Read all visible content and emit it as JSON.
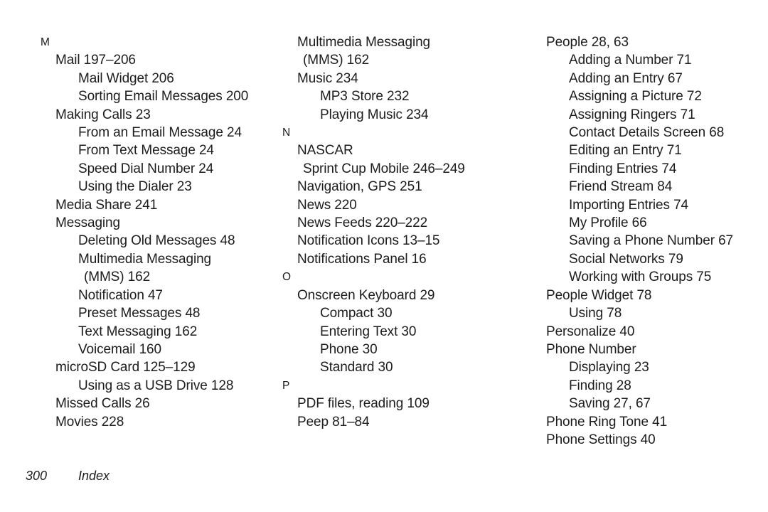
{
  "page": {
    "footer": {
      "page_number": "300",
      "label": "Index"
    }
  },
  "columns": [
    {
      "name": "column-1",
      "entries": [
        {
          "level": "letter",
          "text": "M"
        },
        {
          "level": "level1",
          "text": "Mail 197–206"
        },
        {
          "level": "level2",
          "text": "Mail Widget 206"
        },
        {
          "level": "level2",
          "text": "Sorting Email Messages 200"
        },
        {
          "level": "level1",
          "text": "Making Calls 23"
        },
        {
          "level": "level2",
          "text": "From an Email Message 24"
        },
        {
          "level": "level2",
          "text": "From Text Message 24"
        },
        {
          "level": "level2",
          "text": "Speed Dial Number 24"
        },
        {
          "level": "level2",
          "text": "Using the Dialer 23"
        },
        {
          "level": "level1",
          "text": "Media Share 241"
        },
        {
          "level": "level1",
          "text": "Messaging"
        },
        {
          "level": "level2",
          "text": "Deleting Old Messages 48"
        },
        {
          "level": "level2",
          "text": "Multimedia Messaging"
        },
        {
          "level": "cont2",
          "text": "(MMS) 162"
        },
        {
          "level": "level2",
          "text": "Notification 47"
        },
        {
          "level": "level2",
          "text": "Preset Messages 48"
        },
        {
          "level": "level2",
          "text": "Text Messaging 162"
        },
        {
          "level": "level2",
          "text": "Voicemail 160"
        },
        {
          "level": "level1",
          "text": "microSD Card 125–129"
        },
        {
          "level": "level2",
          "text": "Using as a USB Drive 128"
        },
        {
          "level": "level1",
          "text": "Missed Calls 26"
        },
        {
          "level": "level1",
          "text": "Movies 228"
        }
      ]
    },
    {
      "name": "column-2",
      "entries": [
        {
          "level": "level1",
          "text": "Multimedia Messaging"
        },
        {
          "level": "cont1",
          "text": "(MMS) 162"
        },
        {
          "level": "level1",
          "text": "Music 234"
        },
        {
          "level": "level2",
          "text": "MP3 Store 232"
        },
        {
          "level": "level2",
          "text": "Playing Music 234"
        },
        {
          "level": "letter",
          "text": "N"
        },
        {
          "level": "level1",
          "text": "NASCAR"
        },
        {
          "level": "cont1",
          "text": "Sprint Cup Mobile 246–249"
        },
        {
          "level": "level1",
          "text": "Navigation, GPS 251"
        },
        {
          "level": "level1",
          "text": "News 220"
        },
        {
          "level": "level1",
          "text": "News Feeds 220–222"
        },
        {
          "level": "level1",
          "text": "Notification Icons 13–15"
        },
        {
          "level": "level1",
          "text": "Notifications Panel 16"
        },
        {
          "level": "letter",
          "text": "O"
        },
        {
          "level": "level1",
          "text": "Onscreen Keyboard 29"
        },
        {
          "level": "level2",
          "text": "Compact 30"
        },
        {
          "level": "level2",
          "text": "Entering Text 30"
        },
        {
          "level": "level2",
          "text": "Phone 30"
        },
        {
          "level": "level2",
          "text": "Standard 30"
        },
        {
          "level": "letter",
          "text": "P"
        },
        {
          "level": "level1",
          "text": "PDF files, reading 109"
        },
        {
          "level": "level1",
          "text": "Peep 81–84"
        }
      ]
    },
    {
      "name": "column-3",
      "entries": [
        {
          "level": "level1",
          "text": "People 28, 63"
        },
        {
          "level": "level2",
          "text": "Adding a Number 71"
        },
        {
          "level": "level2",
          "text": "Adding an Entry 67"
        },
        {
          "level": "level2",
          "text": "Assigning a Picture 72"
        },
        {
          "level": "level2",
          "text": "Assigning Ringers 71"
        },
        {
          "level": "level2",
          "text": "Contact Details Screen 68"
        },
        {
          "level": "level2",
          "text": "Editing an Entry 71"
        },
        {
          "level": "level2",
          "text": "Finding Entries 74"
        },
        {
          "level": "level2",
          "text": "Friend Stream 84"
        },
        {
          "level": "level2",
          "text": "Importing Entries 74"
        },
        {
          "level": "level2",
          "text": "My Profile 66"
        },
        {
          "level": "level2",
          "text": "Saving a Phone Number 67"
        },
        {
          "level": "level2",
          "text": "Social Networks 79"
        },
        {
          "level": "level2",
          "text": "Working with Groups 75"
        },
        {
          "level": "level1",
          "text": "People Widget 78"
        },
        {
          "level": "level2",
          "text": "Using 78"
        },
        {
          "level": "level1",
          "text": "Personalize 40"
        },
        {
          "level": "level1",
          "text": "Phone Number"
        },
        {
          "level": "level2",
          "text": "Displaying 23"
        },
        {
          "level": "level2",
          "text": "Finding 28"
        },
        {
          "level": "level2",
          "text": "Saving 27, 67"
        },
        {
          "level": "level1",
          "text": "Phone Ring Tone 41"
        },
        {
          "level": "level1",
          "text": "Phone Settings 40"
        }
      ]
    }
  ]
}
